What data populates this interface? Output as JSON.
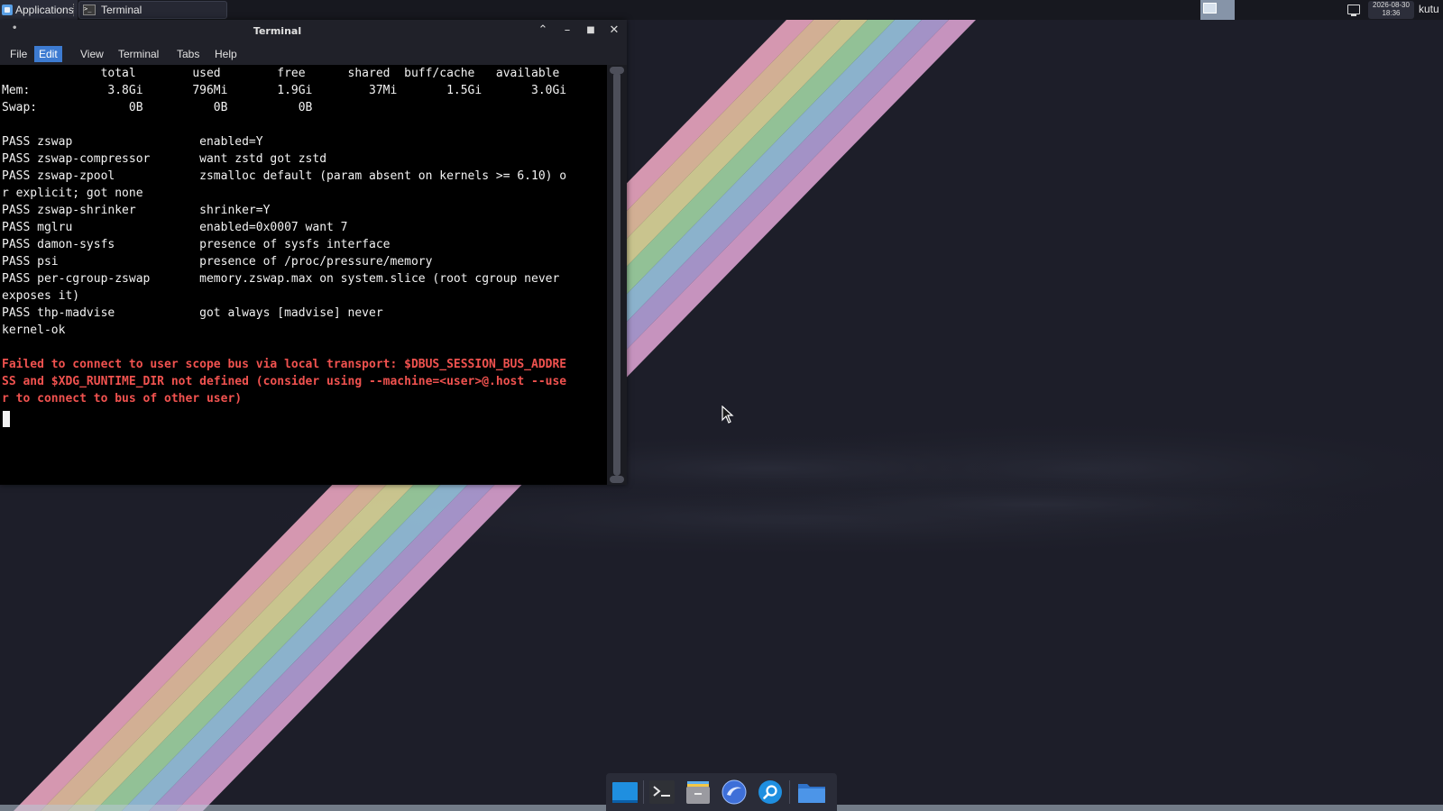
{
  "panel": {
    "apps_label": "Applications",
    "task_label": "Terminal",
    "clock_date": "2026-08-30",
    "clock_time": "18:36",
    "user_label": "kutu"
  },
  "terminal": {
    "title": "Terminal",
    "menu": [
      "File",
      "Edit",
      "View",
      "Terminal",
      "Tabs",
      "Help"
    ],
    "active_menu": "Edit",
    "lines": [
      "              total        used        free      shared  buff/cache   available",
      "Mem:           3.8Gi       796Mi       1.9Gi        37Mi       1.5Gi       3.0Gi",
      "Swap:             0B          0B          0B",
      "",
      "PASS zswap                  enabled=Y",
      "PASS zswap-compressor       want zstd got zstd",
      "PASS zswap-zpool            zsmalloc default (param absent on kernels >= 6.10) o",
      "r explicit; got none",
      "PASS zswap-shrinker         shrinker=Y",
      "PASS mglru                  enabled=0x0007 want 7",
      "PASS damon-sysfs            presence of sysfs interface",
      "PASS psi                    presence of /proc/pressure/memory",
      "PASS per-cgroup-zswap       memory.zswap.max on system.slice (root cgroup never",
      "exposes it)",
      "PASS thp-madvise            got always [madvise] never",
      "kernel-ok",
      ""
    ],
    "error_lines": [
      "Failed to connect to user scope bus via local transport: $DBUS_SESSION_BUS_ADDRE",
      "SS and $XDG_RUNTIME_DIR not defined (consider using --machine=<user>@.host --use",
      "r to connect to bus of other user)"
    ]
  },
  "dock": {
    "items": [
      "show-desktop-icon",
      "terminal-icon",
      "file-manager-icon",
      "web-browser-icon",
      "app-finder-icon",
      "folder-icon"
    ]
  },
  "colors": {
    "error_text": "#f0524f",
    "menu_highlight": "#3d7bd1",
    "desktop_bg": "#1d1e29"
  }
}
